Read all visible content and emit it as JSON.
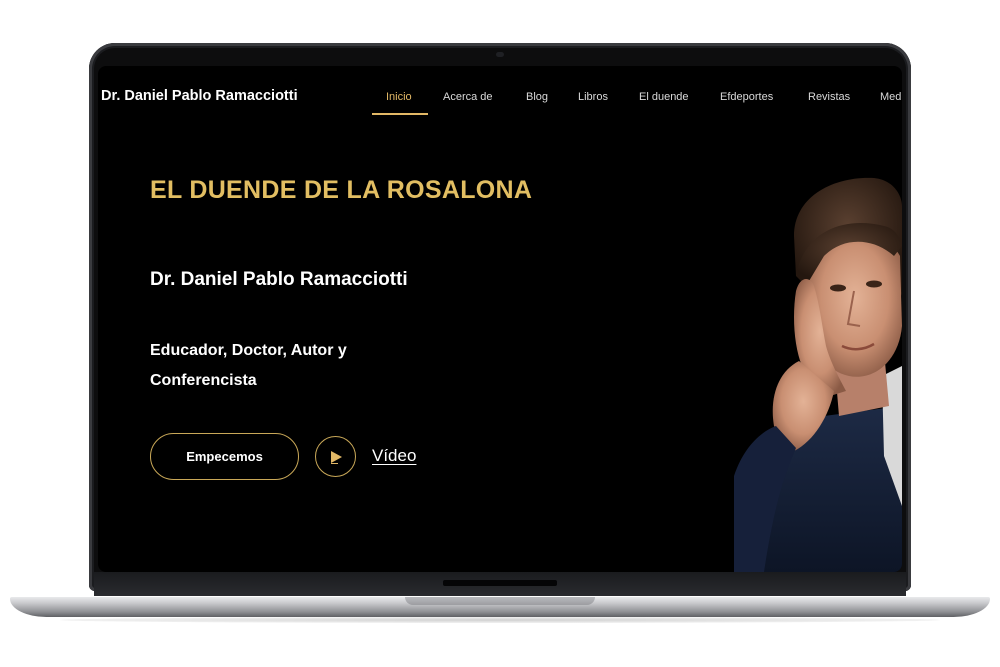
{
  "site": {
    "brand": "Dr. Daniel Pablo Ramacciotti",
    "nav": [
      {
        "label": "Inicio",
        "active": true
      },
      {
        "label": "Acerca de",
        "active": false
      },
      {
        "label": "Blog",
        "active": false
      },
      {
        "label": "Libros",
        "active": false
      },
      {
        "label": "El duende",
        "active": false
      },
      {
        "label": "Efdeportes",
        "active": false
      },
      {
        "label": "Revistas",
        "active": false
      },
      {
        "label": "Med",
        "active": false
      }
    ]
  },
  "hero": {
    "title": "EL DUENDE DE LA ROSALONA",
    "name": "Dr. Daniel Pablo Ramacciotti",
    "description": "Educador, Doctor, Autor y Conferencista",
    "cta_label": "Empecemos",
    "video_label": "Vídeo",
    "play_icon": "play-icon",
    "portrait": "author-portrait-photo"
  },
  "colors": {
    "background": "#000000",
    "accent_gold": "#e2be62",
    "text": "#ffffff",
    "nav_text": "#d9d9d9"
  }
}
